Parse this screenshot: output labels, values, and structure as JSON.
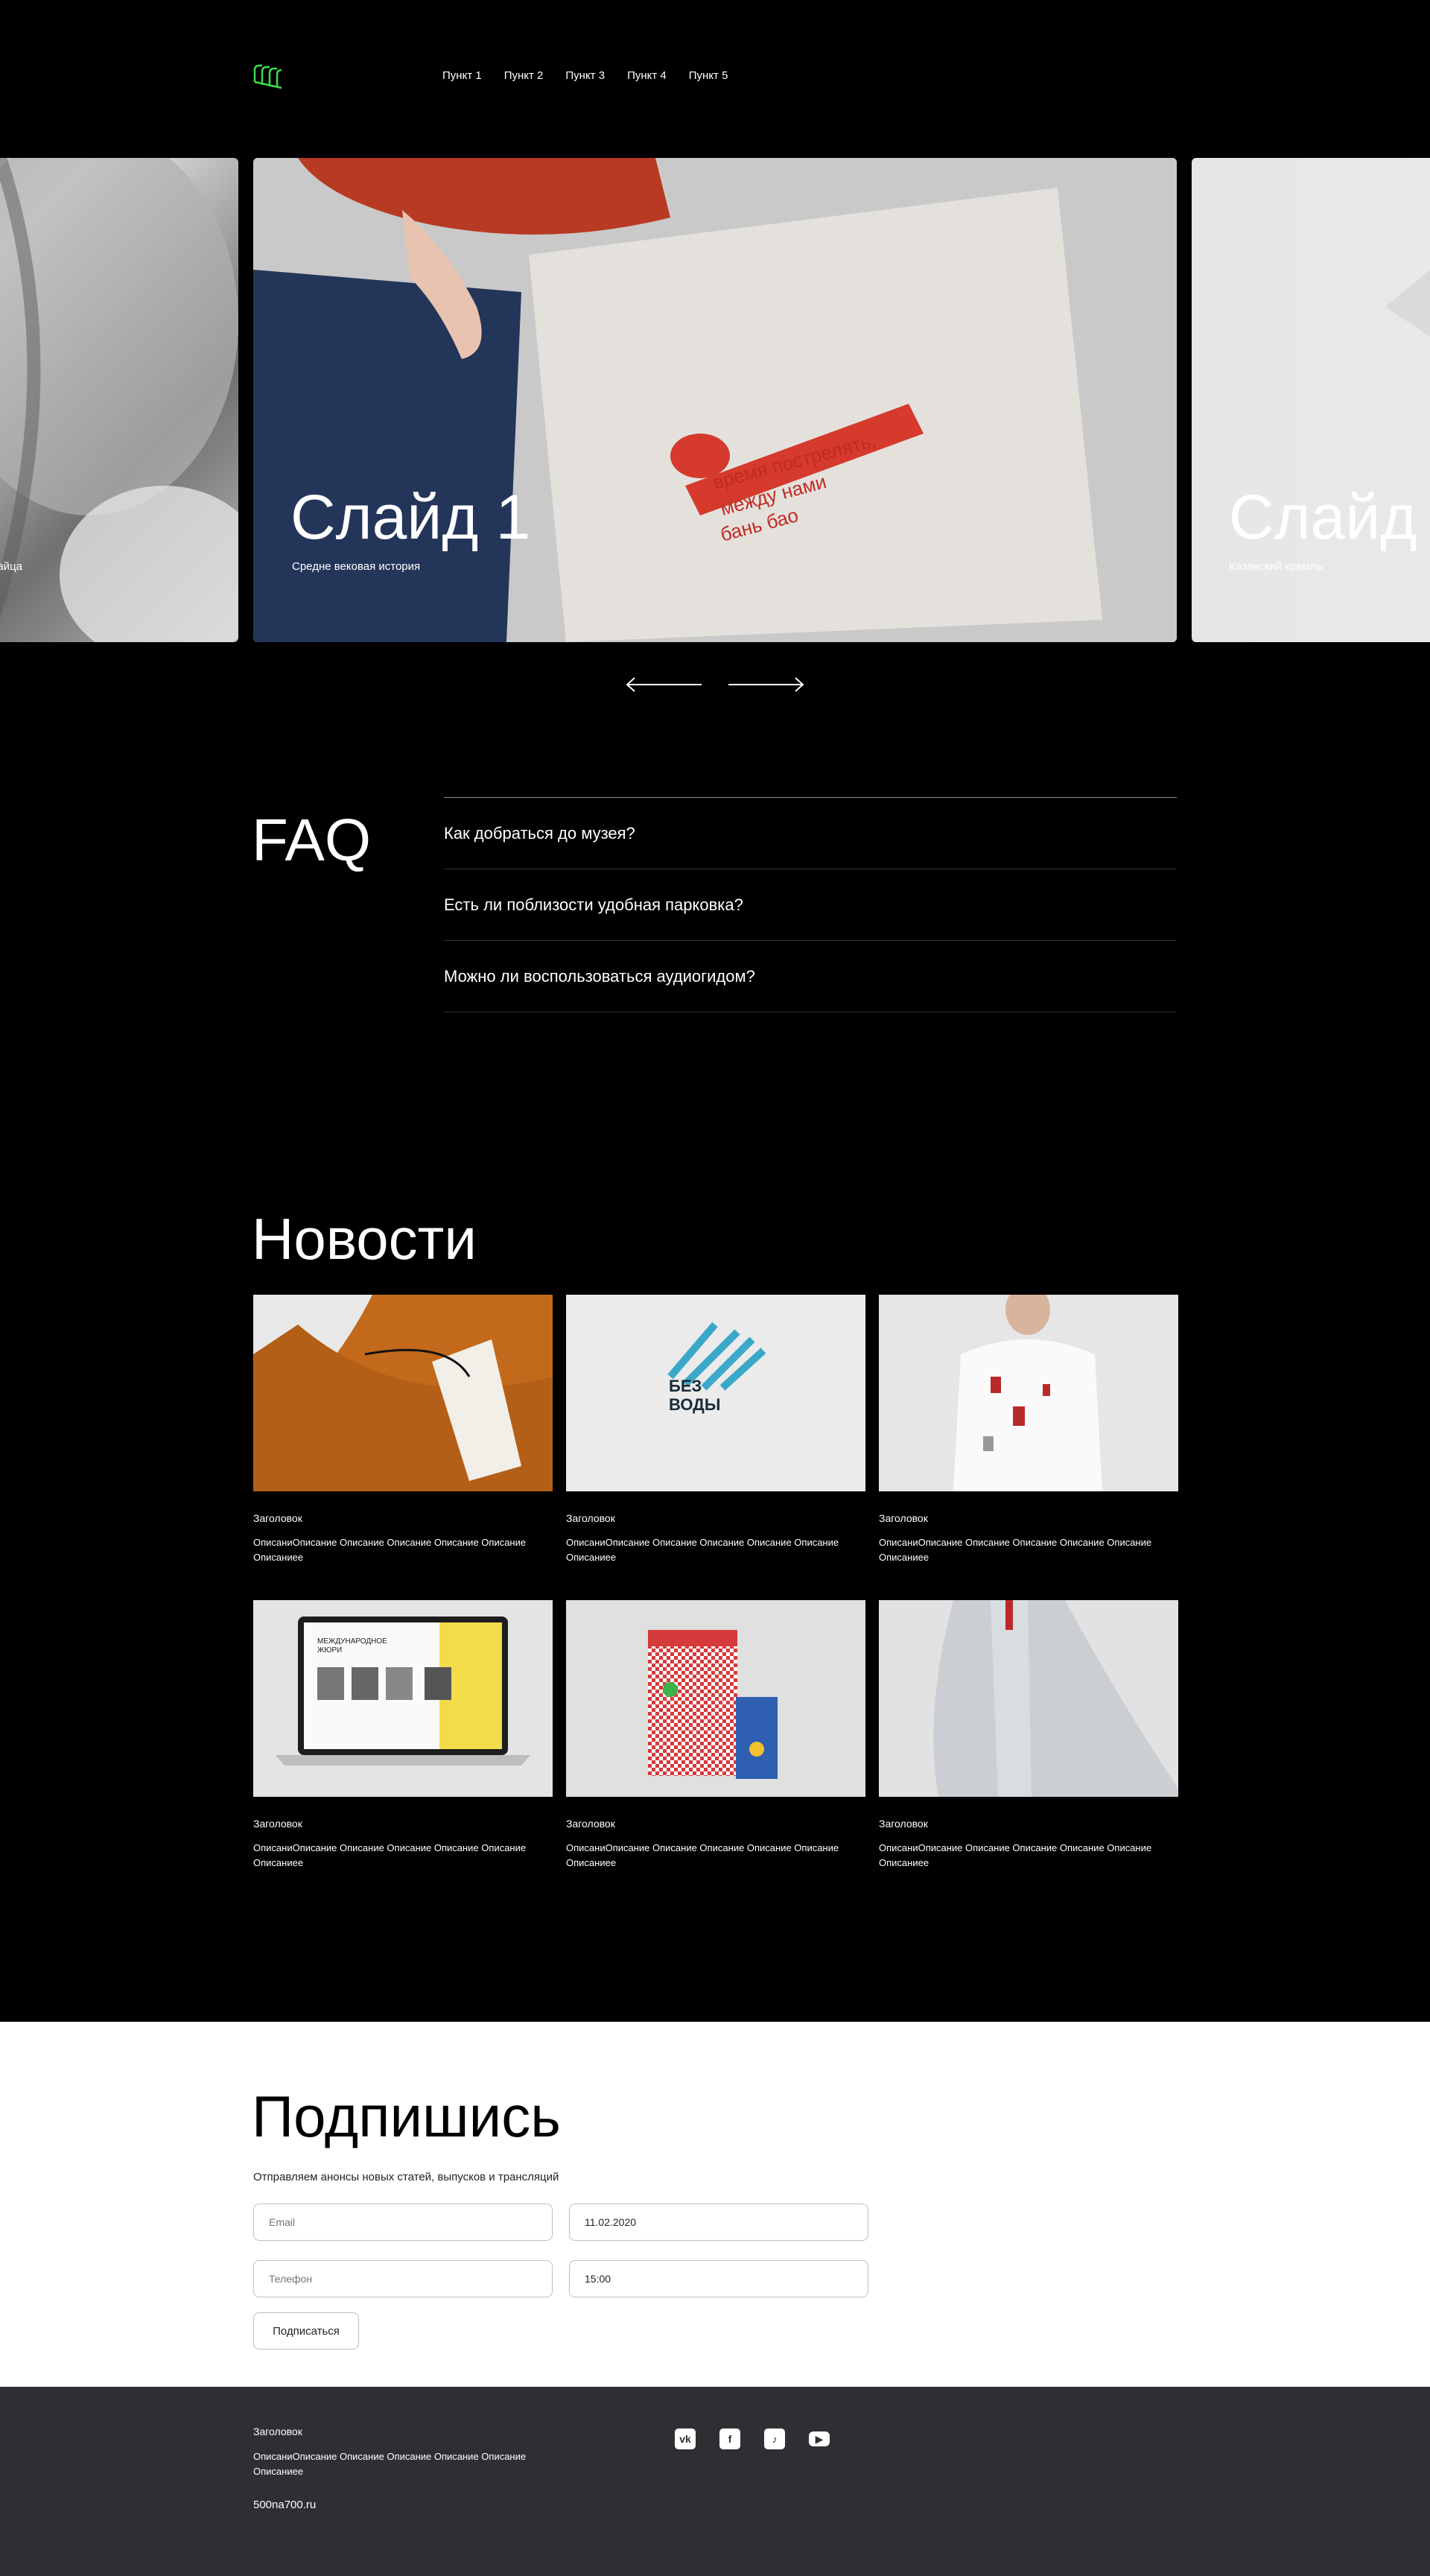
{
  "header": {
    "nav": [
      "Пункт 1",
      "Пункт 2",
      "Пункт 3",
      "Пункт 4",
      "Пункт 5"
    ],
    "logo_color": "#3ddc4a"
  },
  "slider": {
    "prev": {
      "description": "дгайца"
    },
    "current": {
      "title": "Слайд 1",
      "description": "Средне вековая история",
      "bag_text": [
        "время пострелять,",
        "между нами",
        "бань бао"
      ]
    },
    "next": {
      "title": "Слайд",
      "description": "Казанский кремль"
    }
  },
  "faq": {
    "title": "FAQ",
    "items": [
      "Как добраться до музея?",
      "Есть ли поблизости удобная парковка?",
      "Можно ли воспользоваться аудиогидом?"
    ]
  },
  "news": {
    "title": "Новости",
    "cards": [
      {
        "heading": "Заголовок",
        "description": "ОписаниОписание Описание Описание Описание Описание Описаниее"
      },
      {
        "heading": "Заголовок",
        "description": "ОписаниОписание Описание Описание Описание Описание Описаниее",
        "art_text": [
          "БЕЗ",
          "ВОДЫ"
        ]
      },
      {
        "heading": "Заголовок",
        "description": "ОписаниОписание Описание Описание Описание Описание Описаниее"
      },
      {
        "heading": "Заголовок",
        "description": "ОписаниОписание Описание Описание Описание Описание Описаниее",
        "art_text": [
          "МЕЖДУНАРОДНОЕ",
          "ЖЮРИ"
        ]
      },
      {
        "heading": "Заголовок",
        "description": "ОписаниОписание Описание Описание Описание Описание Описаниее"
      },
      {
        "heading": "Заголовок",
        "description": "ОписаниОписание Описание Описание Описание Описание Описаниее"
      }
    ]
  },
  "subscribe": {
    "title": "Подпишись",
    "text": "Отправляем анонсы новых статей, выпусков и трансляций",
    "email_placeholder": "Email",
    "date_value": "11.02.2020",
    "phone_placeholder": "Телефон",
    "time_value": "15:00",
    "button": "Подписаться"
  },
  "footer": {
    "heading": "Заголовок",
    "description": "ОписаниОписание Описание Описание Описание Описание Описаниее",
    "link": "500na700.ru",
    "socials": [
      "vk-icon",
      "facebook-icon",
      "tiktok-icon",
      "youtube-icon"
    ],
    "background": "#2f2e33"
  }
}
